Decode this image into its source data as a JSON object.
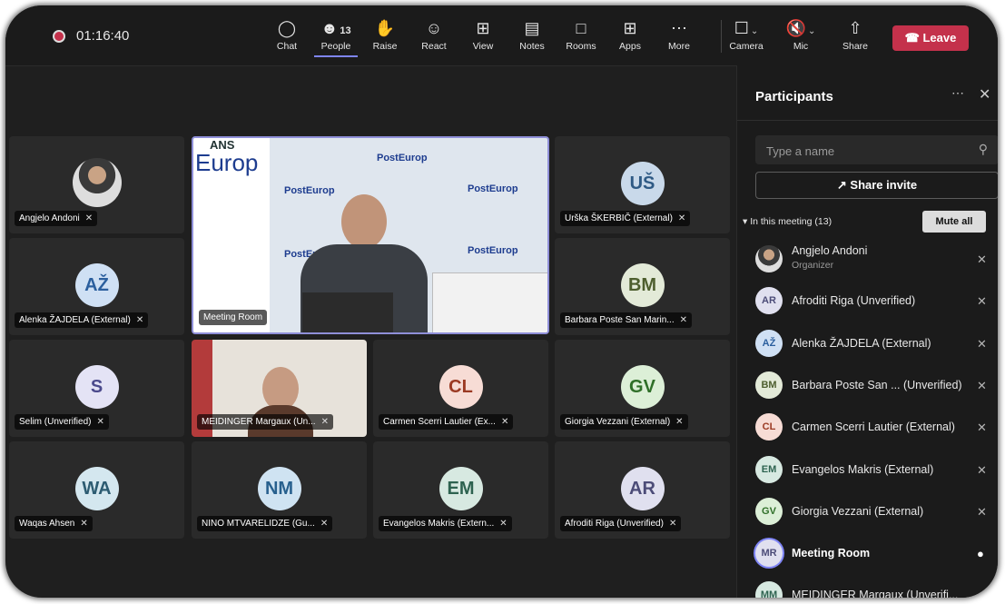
{
  "topbar": {
    "timer": "01:16:40",
    "buttons": [
      {
        "label": "Chat",
        "icon": "chat-icon"
      },
      {
        "label": "People",
        "icon": "people-icon",
        "badge": "13"
      },
      {
        "label": "Raise",
        "icon": "hand-icon"
      },
      {
        "label": "React",
        "icon": "smile-icon"
      },
      {
        "label": "View",
        "icon": "grid-icon"
      },
      {
        "label": "Notes",
        "icon": "notes-icon"
      },
      {
        "label": "Rooms",
        "icon": "rooms-icon"
      },
      {
        "label": "Apps",
        "icon": "apps-icon"
      },
      {
        "label": "More",
        "icon": "more-icon"
      }
    ],
    "camera_label": "Camera",
    "mic_label": "Mic",
    "share_label": "Share",
    "leave_label": "Leave"
  },
  "tiles": [
    {
      "name": "Angjelo Andoni",
      "initials": "",
      "photo": true
    },
    {
      "name": "Meeting Room",
      "initials": "",
      "video": true,
      "banner_top": "ANS",
      "banner_left": "Europ",
      "banner_text": "PostEurop"
    },
    {
      "name": "Urška ŠKERBIČ (External)",
      "initials": "UŠ",
      "color": "#c9d9ea",
      "text": "#2f5a85"
    },
    {
      "name": "Alenka ŽAJDELA (External)",
      "initials": "AŽ",
      "color": "#cfe0f4",
      "text": "#2b5f9e"
    },
    {
      "name": "Barbara Poste San Marin...",
      "initials": "BM",
      "color": "#e3ead8",
      "text": "#4d5e2e"
    },
    {
      "name": "Selim (Unverified)",
      "initials": "S",
      "color": "#e4e3f5",
      "text": "#4b4a8c"
    },
    {
      "name": "MEIDINGER Margaux (Un...",
      "initials": "",
      "photo2": true
    },
    {
      "name": "Carmen Scerri Lautier (Ex...",
      "initials": "CL",
      "color": "#f7dcd5",
      "text": "#9b3a23"
    },
    {
      "name": "Giorgia Vezzani (External)",
      "initials": "GV",
      "color": "#dcefd7",
      "text": "#2f6f28"
    },
    {
      "name": "Waqas Ahsen",
      "initials": "WA",
      "color": "#d4e7ef",
      "text": "#2d5c72"
    },
    {
      "name": "NINO MTVARELIDZE (Gu...",
      "initials": "NM",
      "color": "#cfe3f2",
      "text": "#27608e"
    },
    {
      "name": "Evangelos Makris (Extern...",
      "initials": "EM",
      "color": "#d7e9e1",
      "text": "#2e6350"
    },
    {
      "name": "Afroditi Riga (Unverified)",
      "initials": "AR",
      "color": "#e0e0ef",
      "text": "#4c4c78"
    }
  ],
  "panel": {
    "title": "Participants",
    "search_placeholder": "Type a name",
    "invite_label": "Share invite",
    "section_label": "In this meeting (13)",
    "mute_all_label": "Mute all",
    "participants": [
      {
        "name": "Angjelo Andoni",
        "sub": "Organizer",
        "initials": "",
        "photo": true,
        "bold": false
      },
      {
        "name": "Afroditi Riga (Unverified)",
        "initials": "AR",
        "color": "#e0e0ef",
        "text": "#4c4c78"
      },
      {
        "name": "Alenka ŽAJDELA (External)",
        "initials": "AŽ",
        "color": "#cfe0f4",
        "text": "#2b5f9e"
      },
      {
        "name": "Barbara Poste San ... (Unverified)",
        "initials": "BM",
        "color": "#e3ead8",
        "text": "#4d5e2e"
      },
      {
        "name": "Carmen Scerri Lautier (External)",
        "initials": "CL",
        "color": "#f7dcd5",
        "text": "#9b3a23"
      },
      {
        "name": "Evangelos Makris (External)",
        "initials": "EM",
        "color": "#d7e9e1",
        "text": "#2e6350"
      },
      {
        "name": "Giorgia Vezzani (External)",
        "initials": "GV",
        "color": "#dcefd7",
        "text": "#2f6f28"
      },
      {
        "name": "Meeting Room",
        "initials": "MR",
        "color": "#e0e0ef",
        "text": "#4c4c78",
        "bold": true,
        "speaking": true
      },
      {
        "name": "MEIDINGER Margaux (Unverifi...",
        "initials": "MM",
        "color": "#d7e9e1",
        "text": "#2e6350"
      }
    ]
  },
  "colors": {
    "leave": "#c4314b",
    "accent": "#7f85f5",
    "background": "#1f1f1f"
  }
}
